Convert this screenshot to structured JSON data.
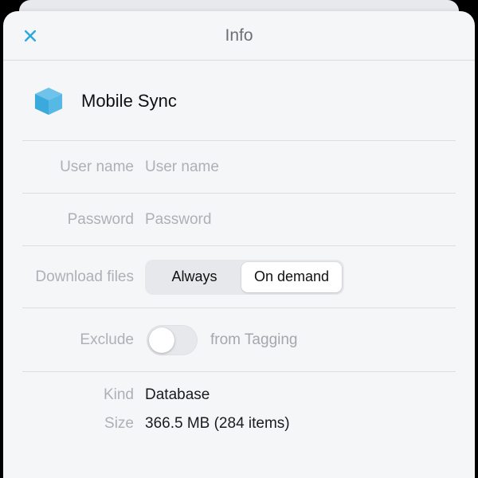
{
  "header": {
    "title": "Info"
  },
  "item": {
    "name": "Mobile Sync"
  },
  "fields": {
    "username_label": "User name",
    "username_placeholder": "User name",
    "username_value": "",
    "password_label": "Password",
    "password_placeholder": "Password",
    "password_value": ""
  },
  "download": {
    "label": "Download files",
    "options": [
      "Always",
      "On demand"
    ],
    "selected_index": 1
  },
  "exclude": {
    "label_before": "Exclude",
    "label_after": "from Tagging",
    "on": false
  },
  "meta": {
    "kind_label": "Kind",
    "kind_value": "Database",
    "size_label": "Size",
    "size_value": "366.5 MB (284 items)"
  }
}
